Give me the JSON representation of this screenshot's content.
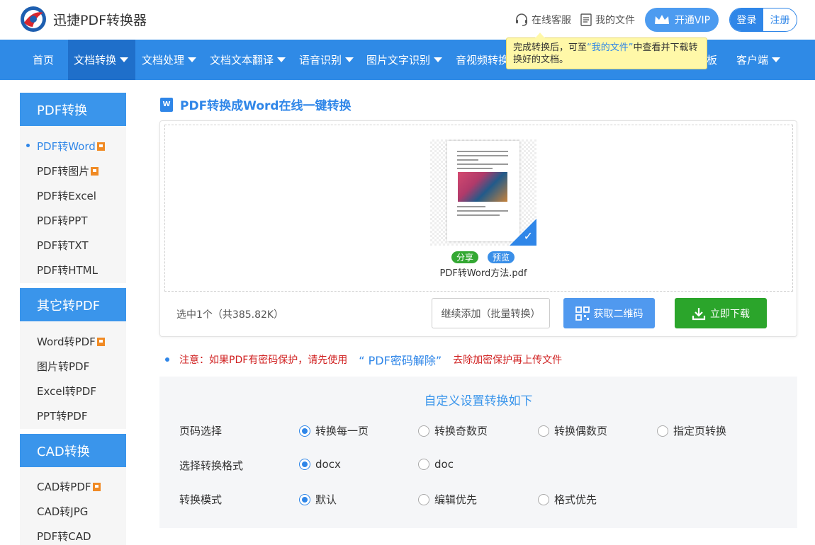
{
  "header": {
    "brand": "迅捷PDF转换器",
    "service_label": "在线客服",
    "files_label": "我的文件",
    "vip_label": "开通VIP",
    "login_label": "登录",
    "register_label": "注册"
  },
  "nav": {
    "items": [
      {
        "label": "首页"
      },
      {
        "label": "文档转换"
      },
      {
        "label": "文档处理"
      },
      {
        "label": "文档文本翻译"
      },
      {
        "label": "语音识别"
      },
      {
        "label": "图片文字识别"
      },
      {
        "label": "音视频转换"
      },
      {
        "label": "板"
      },
      {
        "label": "客户端"
      }
    ]
  },
  "tooltip": {
    "prefix": "完成转换后，可至",
    "link": "“我的文件”",
    "suffix": "中查看并下载转换好的文档。"
  },
  "sidebar": {
    "sections": [
      {
        "title": "PDF转换",
        "items": [
          "PDF转Word",
          "PDF转图片",
          "PDF转Excel",
          "PDF转PPT",
          "PDF转TXT",
          "PDF转HTML"
        ]
      },
      {
        "title": "其它转PDF",
        "items": [
          "Word转PDF",
          "图片转PDF",
          "Excel转PDF",
          "PPT转PDF"
        ]
      },
      {
        "title": "CAD转换",
        "items": [
          "CAD转PDF",
          "CAD转JPG",
          "PDF转CAD"
        ]
      }
    ]
  },
  "main": {
    "title": "PDF转换成Word在线一键转换",
    "doc_icon_letter": "W",
    "share_label": "分享",
    "preview_label": "预览",
    "file_name": "PDF转Word方法.pdf",
    "selection_info": "选中1个（共385.82K）",
    "add_more_label": "继续添加（批量转换）",
    "qr_label": "获取二维码",
    "download_label": "立即下载"
  },
  "notice": {
    "prefix": "注意：如果PDF有密码保护，请先使用",
    "link": "“ PDF密码解除”",
    "suffix": "去除加密保护再上传文件"
  },
  "settings": {
    "title": "自定义设置转换如下",
    "rows": [
      {
        "label": "页码选择",
        "options": [
          "转换每一页",
          "转换奇数页",
          "转换偶数页",
          "指定页转换"
        ],
        "selected": 0
      },
      {
        "label": "选择转换格式",
        "options": [
          "docx",
          "doc"
        ],
        "selected": 0
      },
      {
        "label": "转换模式",
        "options": [
          "默认",
          "编辑优先",
          "格式优先"
        ],
        "selected": 0
      }
    ]
  },
  "colors": {
    "primary": "#2f8ae6",
    "accent_blue": "#2f86e8",
    "download_green": "#2ba52b",
    "notice_red": "#d02020"
  }
}
